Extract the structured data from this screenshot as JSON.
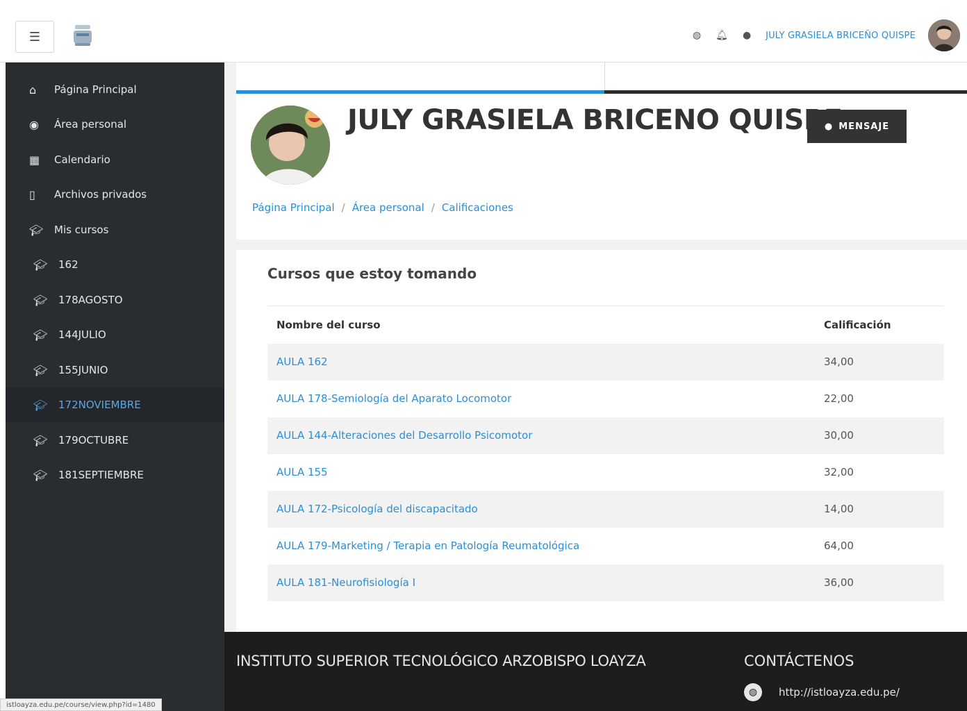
{
  "navbar": {
    "user_name": "JULY GRASIELA BRICEÑO QUISPE",
    "icons": [
      "globe-icon",
      "bell-icon",
      "comment-icon"
    ]
  },
  "sidebar": {
    "items": [
      {
        "label": "Página Principal",
        "icon": "home-icon"
      },
      {
        "label": "Área personal",
        "icon": "dashboard-icon"
      },
      {
        "label": "Calendario",
        "icon": "calendar-icon"
      },
      {
        "label": "Archivos privados",
        "icon": "file-icon"
      },
      {
        "label": "Mis cursos",
        "icon": "graduation-cap-icon"
      },
      {
        "label": "162",
        "icon": "graduation-cap-icon"
      },
      {
        "label": "178AGOSTO",
        "icon": "graduation-cap-icon"
      },
      {
        "label": "144JULIO",
        "icon": "graduation-cap-icon"
      },
      {
        "label": "155JUNIO",
        "icon": "graduation-cap-icon"
      },
      {
        "label": "172NOVIEMBRE",
        "icon": "graduation-cap-icon"
      },
      {
        "label": "179OCTUBRE",
        "icon": "graduation-cap-icon"
      },
      {
        "label": "181SEPTIEMBRE",
        "icon": "graduation-cap-icon"
      }
    ]
  },
  "header": {
    "title": "JULY GRASIELA BRICENO QUISPE",
    "message_button": "MENSAJE",
    "breadcrumb": [
      "Página Principal",
      "Área personal",
      "Calificaciones"
    ]
  },
  "content": {
    "title": "Cursos que estoy tomando",
    "columns": [
      "Nombre del curso",
      "Calificación"
    ],
    "rows": [
      {
        "course": "AULA 162",
        "grade": "34,00"
      },
      {
        "course": "AULA 178-Semiología del Aparato Locomotor",
        "grade": "22,00"
      },
      {
        "course": "AULA 144-Alteraciones del Desarrollo Psicomotor",
        "grade": "30,00"
      },
      {
        "course": "AULA 155",
        "grade": "32,00"
      },
      {
        "course": "AULA 172-Psicología del discapacitado",
        "grade": "14,00"
      },
      {
        "course": "AULA 179-Marketing / Terapia en Patología Reumatológica",
        "grade": "64,00"
      },
      {
        "course": "AULA 181-Neurofisiología I",
        "grade": "36,00"
      }
    ]
  },
  "footer": {
    "institution": "INSTITUTO SUPERIOR TECNOLÓGICO ARZOBISPO LOAYZA",
    "contact_title": "CONTÁCTENOS",
    "website": "http://istloayza.edu.pe/"
  },
  "status_bar": {
    "url": "istloayza.edu.pe/course/view.php?id=1480"
  },
  "colors": {
    "accent": "#2a8fd6",
    "sidebar_bg": "#2a2d30",
    "footer_bg": "#1b1d1f"
  }
}
